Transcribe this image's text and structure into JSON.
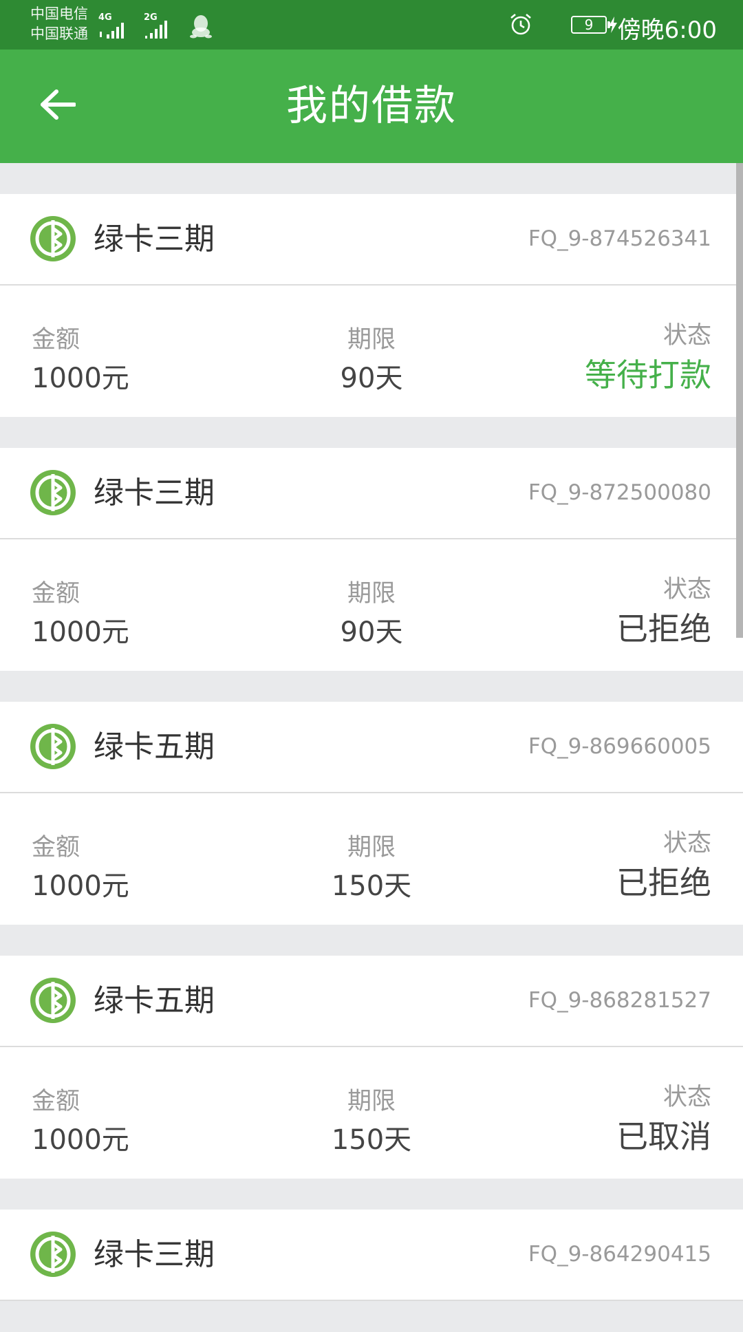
{
  "status_bar": {
    "carrier_1": "中国电信",
    "carrier_2": "中国联通",
    "network_1": "4G",
    "network_2": "2G",
    "battery_level": "9",
    "time": "傍晚6:00"
  },
  "app_bar": {
    "title": "我的借款"
  },
  "labels": {
    "amount": "金额",
    "term": "期限",
    "status": "状态"
  },
  "loans": [
    {
      "product": "绿卡三期",
      "order_no": "FQ_9-874526341",
      "amount": "1000元",
      "term": "90天",
      "status": "等待打款",
      "status_color": "#45b04a"
    },
    {
      "product": "绿卡三期",
      "order_no": "FQ_9-872500080",
      "amount": "1000元",
      "term": "90天",
      "status": "已拒绝",
      "status_color": "#444444"
    },
    {
      "product": "绿卡五期",
      "order_no": "FQ_9-869660005",
      "amount": "1000元",
      "term": "150天",
      "status": "已拒绝",
      "status_color": "#444444"
    },
    {
      "product": "绿卡五期",
      "order_no": "FQ_9-868281527",
      "amount": "1000元",
      "term": "150天",
      "status": "已取消",
      "status_color": "#444444"
    },
    {
      "product": "绿卡三期",
      "order_no": "FQ_9-864290415"
    }
  ],
  "colors": {
    "primary": "#45b04a",
    "status_bar": "#2e8a33",
    "background": "#e9eaec"
  }
}
